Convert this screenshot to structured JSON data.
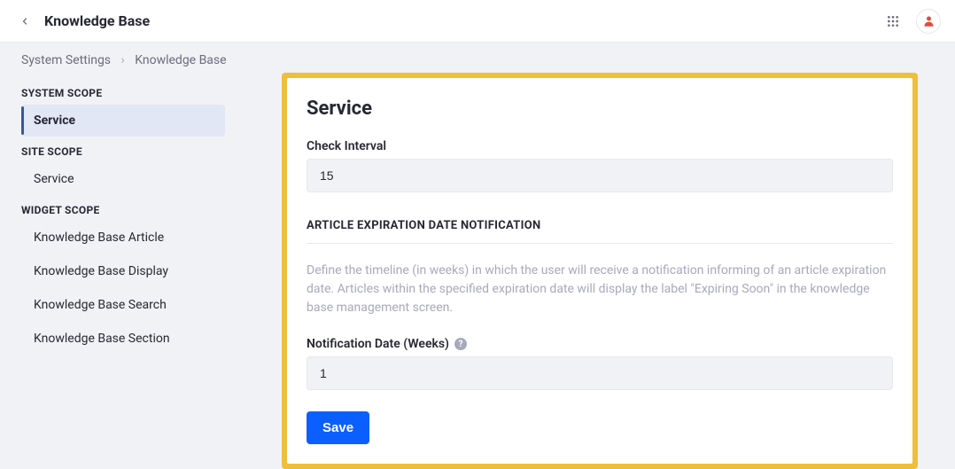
{
  "header": {
    "title": "Knowledge Base"
  },
  "breadcrumb": {
    "root": "System Settings",
    "current": "Knowledge Base",
    "sep": "›"
  },
  "sidebar": {
    "scopes": [
      {
        "label": "SYSTEM SCOPE",
        "items": [
          {
            "label": "Service",
            "active": true
          }
        ]
      },
      {
        "label": "SITE SCOPE",
        "items": [
          {
            "label": "Service",
            "active": false
          }
        ]
      },
      {
        "label": "WIDGET SCOPE",
        "items": [
          {
            "label": "Knowledge Base Article",
            "active": false
          },
          {
            "label": "Knowledge Base Display",
            "active": false
          },
          {
            "label": "Knowledge Base Search",
            "active": false
          },
          {
            "label": "Knowledge Base Section",
            "active": false
          }
        ]
      }
    ]
  },
  "main": {
    "title": "Service",
    "check_interval_label": "Check Interval",
    "check_interval_value": "15",
    "section_header": "ARTICLE EXPIRATION DATE NOTIFICATION",
    "description": "Define the timeline (in weeks) in which the user will receive a notification informing of an article expiration date. Articles within the specified expiration date will display the label \"Expiring Soon\" in the knowledge base management screen.",
    "notification_label": "Notification Date (Weeks)",
    "notification_value": "1",
    "save_label": "Save"
  }
}
